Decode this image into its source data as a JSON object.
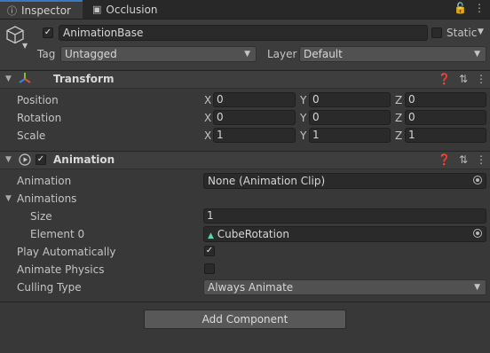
{
  "tabs": [
    {
      "label": "Inspector",
      "icon": "info-icon"
    },
    {
      "label": "Occlusion",
      "icon": "occlusion-icon"
    }
  ],
  "gameobject": {
    "name": "AnimationBase",
    "active": true,
    "static_label": "Static",
    "tag_label": "Tag",
    "tag_value": "Untagged",
    "layer_label": "Layer",
    "layer_value": "Default"
  },
  "transform": {
    "title": "Transform",
    "rows": [
      {
        "label": "Position",
        "x": "0",
        "y": "0",
        "z": "0"
      },
      {
        "label": "Rotation",
        "x": "0",
        "y": "0",
        "z": "0"
      },
      {
        "label": "Scale",
        "x": "1",
        "y": "1",
        "z": "1"
      }
    ],
    "axes": [
      "X",
      "Y",
      "Z"
    ]
  },
  "animation": {
    "title": "Animation",
    "enabled": true,
    "animation_label": "Animation",
    "animation_value": "None (Animation Clip)",
    "animations_label": "Animations",
    "size_label": "Size",
    "size_value": "1",
    "element0_label": "Element 0",
    "element0_value": "CubeRotation",
    "play_auto_label": "Play Automatically",
    "play_auto": true,
    "animate_physics_label": "Animate Physics",
    "animate_physics": false,
    "culling_label": "Culling Type",
    "culling_value": "Always Animate"
  },
  "add_component_label": "Add Component",
  "colors": {
    "background": "#383838",
    "field": "#2a2a2a",
    "accent_tab": "#3a79bb",
    "text": "#c4c4c4"
  }
}
